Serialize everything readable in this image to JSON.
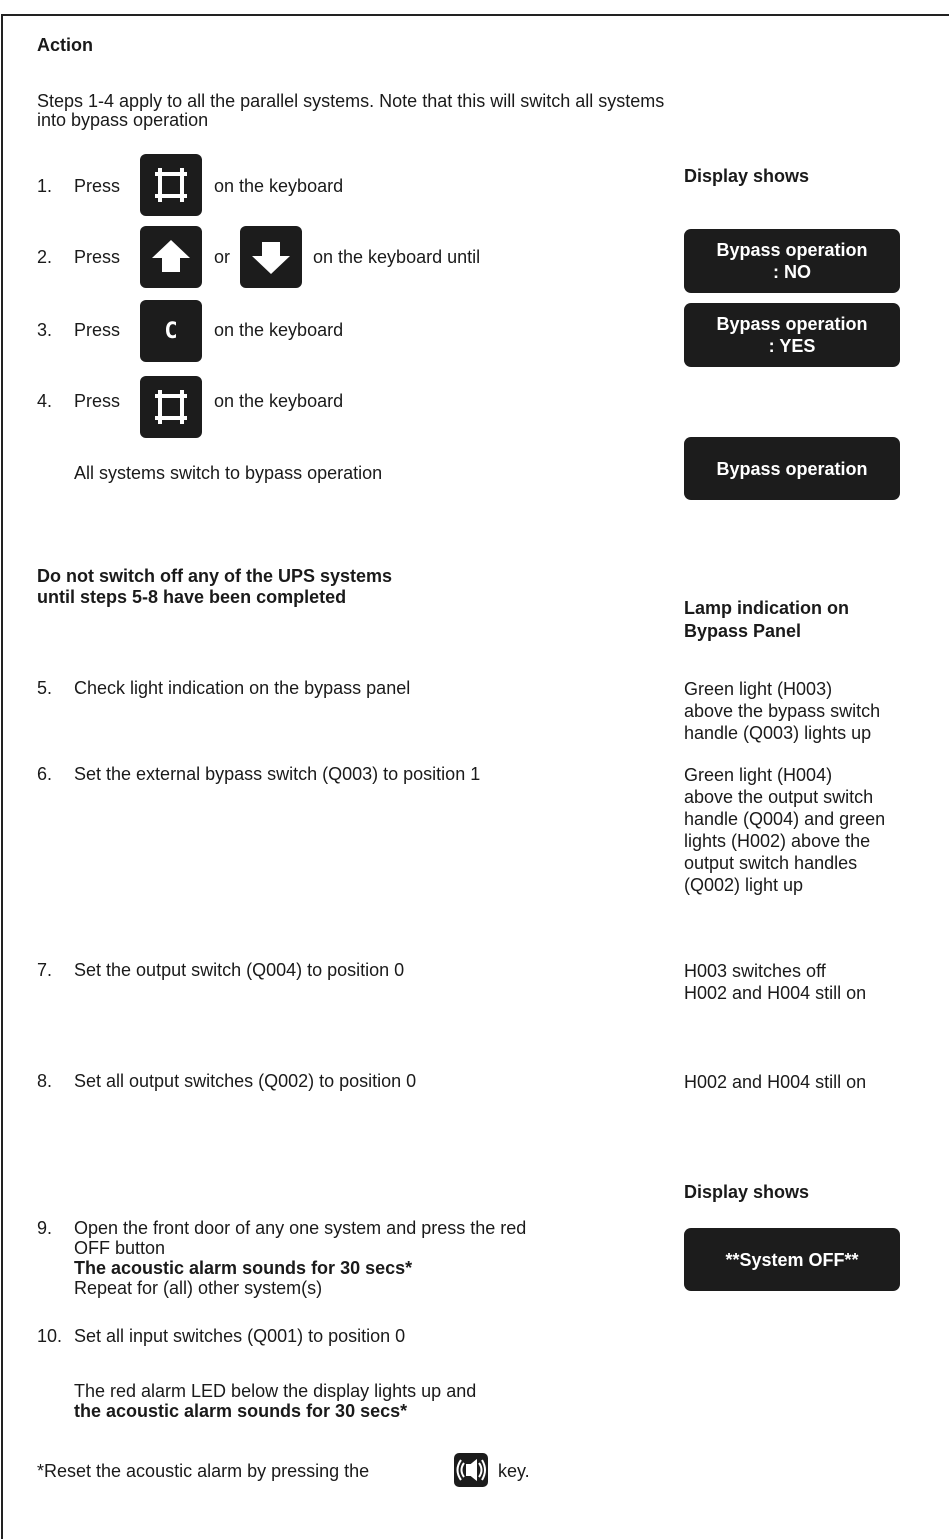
{
  "heading": "Action",
  "intro_line1": "Steps 1-4 apply to all the parallel systems. Note that this will switch all systems",
  "intro_line2": "into bypass operation",
  "display_shows_1": "Display shows",
  "steps": {
    "s1": {
      "num": "1.",
      "press": "Press",
      "after": "on the keyboard"
    },
    "s2": {
      "num": "2.",
      "press": "Press",
      "or": "or",
      "after": "on the keyboard until"
    },
    "s3": {
      "num": "3.",
      "press": "Press",
      "after": "on the keyboard",
      "key_letter": "C"
    },
    "s4": {
      "num": "4.",
      "press": "Press",
      "after": "on the keyboard"
    },
    "s4_result": "All systems switch to bypass operation",
    "s5": {
      "num": "5.",
      "text": "Check light indication on the bypass panel"
    },
    "s6": {
      "num": "6.",
      "text": "Set the external bypass switch (Q003) to position 1"
    },
    "s7": {
      "num": "7.",
      "text": "Set the output switch (Q004) to position 0"
    },
    "s8": {
      "num": "8.",
      "text": "Set all output switches (Q002) to position 0"
    },
    "s9": {
      "num": "9.",
      "line1": "Open the front door of any one system and press the red",
      "line2": "OFF button",
      "line3": "The acoustic alarm sounds for 30 secs*",
      "line4": "Repeat for (all) other system(s)"
    },
    "s10": {
      "num": "10.",
      "text": "Set all input switches (Q001) to position 0",
      "result1": "The red alarm LED below the display lights up and",
      "result2": "the acoustic alarm sounds for 30 secs*"
    }
  },
  "displays": {
    "d1_line1": "Bypass operation",
    "d1_line2": ": NO",
    "d2_line1": "Bypass operation",
    "d2_line2": ": YES",
    "d3": "Bypass operation",
    "d4": "**System OFF**"
  },
  "warning_line1": "Do not switch off any of the UPS systems",
  "warning_line2": "until steps 5-8 have been completed",
  "lamp_heading_line1": "Lamp indication on",
  "lamp_heading_line2": "Bypass Panel",
  "lamps": {
    "l5": [
      "Green light (H003)",
      "above the bypass switch",
      "handle (Q003) lights up"
    ],
    "l6": [
      "Green light (H004)",
      "above the output switch",
      "handle (Q004) and green",
      "lights (H002) above the",
      "output switch handles",
      "(Q002) light up"
    ],
    "l7": [
      "H003 switches off",
      "H002 and H004 still on"
    ],
    "l8": [
      "H002 and H004 still on"
    ]
  },
  "display_shows_2": "Display shows",
  "footnote_before": "*Reset the acoustic alarm by pressing the",
  "footnote_after": "key.",
  "icons": {
    "enter_key": "frame-enter-icon",
    "up_key": "arrow-up-icon",
    "down_key": "arrow-down-icon",
    "clear_key": "c-key-icon",
    "alarm_key": "alarm-reset-icon"
  }
}
